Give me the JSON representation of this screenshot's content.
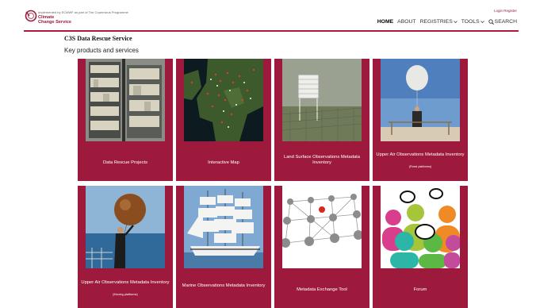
{
  "header": {
    "implemented_by": "Implemented by ECMWF as part of The Copernicus Programme",
    "brand_line1": "Climate",
    "brand_line2": "Change Service",
    "login": "Login Register"
  },
  "nav": {
    "items": [
      {
        "label": "HOME",
        "active": true
      },
      {
        "label": "ABOUT"
      },
      {
        "label": "REGISTRIES"
      },
      {
        "label": "TOOLS"
      },
      {
        "label": "SEARCH"
      }
    ]
  },
  "page": {
    "title": "C3S Data Rescue Service",
    "subtitle": "Key products and services"
  },
  "cards": [
    {
      "title": "Data Rescue Projects",
      "subtitle": "",
      "icon": "archive-shelves-photo"
    },
    {
      "title": "Interactive Map",
      "subtitle": "",
      "icon": "europe-map-photo"
    },
    {
      "title": "Land Surface Observations Metadata Inventory",
      "subtitle": "",
      "icon": "weather-station-photo"
    },
    {
      "title": "Upper Air Observations Metadata Inventory",
      "subtitle": "(Fixed platforms)",
      "icon": "weather-balloon-photo"
    },
    {
      "title": "Upper Air Observations Metadata Inventory",
      "subtitle": "(Moving platforms)",
      "icon": "ship-balloon-photo"
    },
    {
      "title": "Marine Observations Metadata Inventory",
      "subtitle": "",
      "icon": "sailing-ship-photo"
    },
    {
      "title": "Metadata Exchange Tool",
      "subtitle": "",
      "icon": "network-spheres-image"
    },
    {
      "title": "Forum",
      "subtitle": "",
      "icon": "people-speech-bubbles-image"
    }
  ],
  "colors": {
    "accent": "#9e1a3d",
    "brand": "#9c1b3a"
  }
}
